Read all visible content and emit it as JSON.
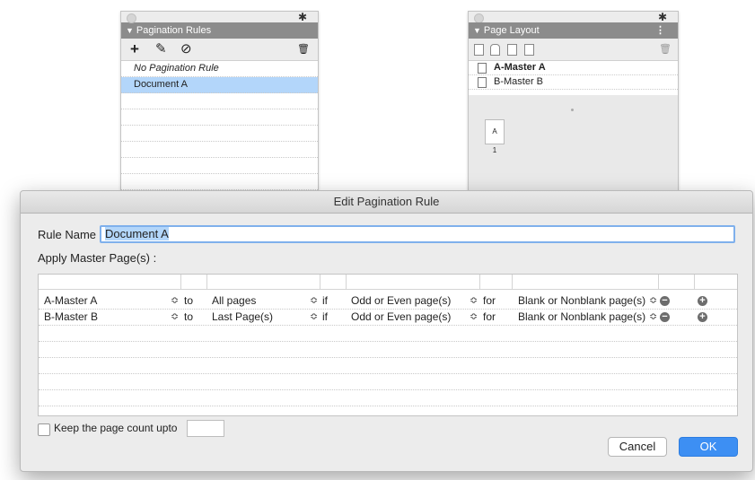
{
  "pagination_panel": {
    "title": "Pagination Rules",
    "toolbar": {
      "add_glyph": "+",
      "edit_glyph": "✎",
      "duplicate_glyph": "⊘",
      "delete_glyph": "🗑"
    },
    "items": [
      {
        "label": "No Pagination Rule",
        "italic": true,
        "selected": false
      },
      {
        "label": "Document A",
        "italic": false,
        "selected": true
      }
    ]
  },
  "page_layout_panel": {
    "title": "Page Layout",
    "masters": [
      {
        "label": "A-Master A",
        "bold": true
      },
      {
        "label": "B-Master B",
        "bold": false
      }
    ],
    "page_thumb": {
      "letter": "A",
      "number": "1"
    }
  },
  "dialog": {
    "title": "Edit Pagination Rule",
    "rule_name_label": "Rule Name",
    "rule_name_value": "Document A",
    "apply_label": "Apply Master Page(s) :",
    "rows": [
      {
        "master": "A-Master A",
        "to": "to",
        "pages": "All pages",
        "if": "if",
        "parity": "Odd or Even page(s)",
        "for": "for",
        "blank": "Blank or Nonblank page(s)"
      },
      {
        "master": "B-Master B",
        "to": "to",
        "pages": "Last Page(s)",
        "if": "if",
        "parity": "Odd or Even page(s)",
        "for": "for",
        "blank": "Blank or Nonblank page(s)"
      }
    ],
    "keep_page_count_label": "Keep the page count upto",
    "keep_page_count_value": "",
    "cancel_label": "Cancel",
    "ok_label": "OK"
  },
  "colors": {
    "selection": "#b3d6fa",
    "ok_button": "#3d8ff3",
    "panel_header": "#8c8c8c"
  },
  "icons": [
    "gear-icon",
    "add-icon",
    "pencil-icon",
    "duplicate-icon",
    "trash-icon",
    "menu-icon",
    "page-icon",
    "minus-circle-icon",
    "plus-circle-icon",
    "stepper-icon"
  ]
}
